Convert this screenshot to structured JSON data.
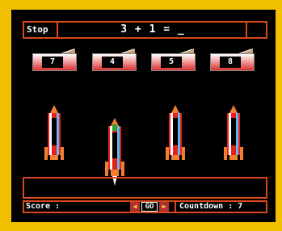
{
  "header": {
    "stop_label": "Stop",
    "equation": "3 + 1 = _"
  },
  "answers": [
    {
      "label": "7"
    },
    {
      "label": "4"
    },
    {
      "label": "5"
    },
    {
      "label": "8"
    }
  ],
  "status": {
    "score_label": "Score :",
    "go_label": "GO",
    "countdown_label": "Countdown : 7"
  },
  "colors": {
    "frame": "#f0c000",
    "background": "#000000",
    "border": "#d84818",
    "tray_top": "#ffffff",
    "tray_bottom": "#d83030",
    "rocket_red": "#e8201c",
    "rocket_orange": "#f08030",
    "rocket_white": "#ffffff",
    "rocket_blue": "#60b8f0"
  }
}
